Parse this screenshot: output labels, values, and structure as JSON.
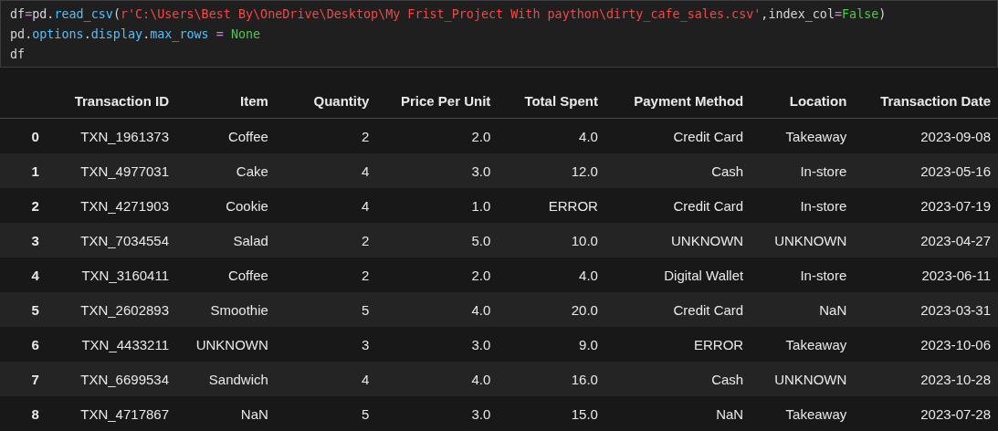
{
  "code_cell": {
    "lines": [
      [
        {
          "text": "df",
          "kind": "plain"
        },
        {
          "text": "=",
          "kind": "operator"
        },
        {
          "text": "pd",
          "kind": "plain"
        },
        {
          "text": ".",
          "kind": "plain"
        },
        {
          "text": "read_csv",
          "kind": "function"
        },
        {
          "text": "(",
          "kind": "plain"
        },
        {
          "text": "r'C:\\Users\\Best By\\OneDrive\\Desktop\\My Frist_Project With paython\\dirty_cafe_sales.csv'",
          "kind": "string"
        },
        {
          "text": ",index_col",
          "kind": "plain"
        },
        {
          "text": "=",
          "kind": "operator"
        },
        {
          "text": "False",
          "kind": "constant"
        },
        {
          "text": ")",
          "kind": "plain"
        }
      ],
      [
        {
          "text": "pd",
          "kind": "plain"
        },
        {
          "text": ".",
          "kind": "plain"
        },
        {
          "text": "options",
          "kind": "function"
        },
        {
          "text": ".",
          "kind": "plain"
        },
        {
          "text": "display",
          "kind": "function"
        },
        {
          "text": ".",
          "kind": "plain"
        },
        {
          "text": "max_rows",
          "kind": "function"
        },
        {
          "text": " = ",
          "kind": "operator"
        },
        {
          "text": "None",
          "kind": "constant"
        }
      ],
      [
        {
          "text": "df",
          "kind": "plain"
        }
      ]
    ]
  },
  "table": {
    "columns": [
      "Transaction ID",
      "Item",
      "Quantity",
      "Price Per Unit",
      "Total Spent",
      "Payment Method",
      "Location",
      "Transaction Date"
    ],
    "rows": [
      {
        "index": "0",
        "cells": [
          "TXN_1961373",
          "Coffee",
          "2",
          "2.0",
          "4.0",
          "Credit Card",
          "Takeaway",
          "2023-09-08"
        ]
      },
      {
        "index": "1",
        "cells": [
          "TXN_4977031",
          "Cake",
          "4",
          "3.0",
          "12.0",
          "Cash",
          "In-store",
          "2023-05-16"
        ]
      },
      {
        "index": "2",
        "cells": [
          "TXN_4271903",
          "Cookie",
          "4",
          "1.0",
          "ERROR",
          "Credit Card",
          "In-store",
          "2023-07-19"
        ]
      },
      {
        "index": "3",
        "cells": [
          "TXN_7034554",
          "Salad",
          "2",
          "5.0",
          "10.0",
          "UNKNOWN",
          "UNKNOWN",
          "2023-04-27"
        ]
      },
      {
        "index": "4",
        "cells": [
          "TXN_3160411",
          "Coffee",
          "2",
          "2.0",
          "4.0",
          "Digital Wallet",
          "In-store",
          "2023-06-11"
        ]
      },
      {
        "index": "5",
        "cells": [
          "TXN_2602893",
          "Smoothie",
          "5",
          "4.0",
          "20.0",
          "Credit Card",
          "NaN",
          "2023-03-31"
        ]
      },
      {
        "index": "6",
        "cells": [
          "TXN_4433211",
          "UNKNOWN",
          "3",
          "3.0",
          "9.0",
          "ERROR",
          "Takeaway",
          "2023-10-06"
        ]
      },
      {
        "index": "7",
        "cells": [
          "TXN_6699534",
          "Sandwich",
          "4",
          "4.0",
          "16.0",
          "Cash",
          "UNKNOWN",
          "2023-10-28"
        ]
      },
      {
        "index": "8",
        "cells": [
          "TXN_4717867",
          "NaN",
          "5",
          "3.0",
          "15.0",
          "NaN",
          "Takeaway",
          "2023-07-28"
        ]
      }
    ]
  }
}
